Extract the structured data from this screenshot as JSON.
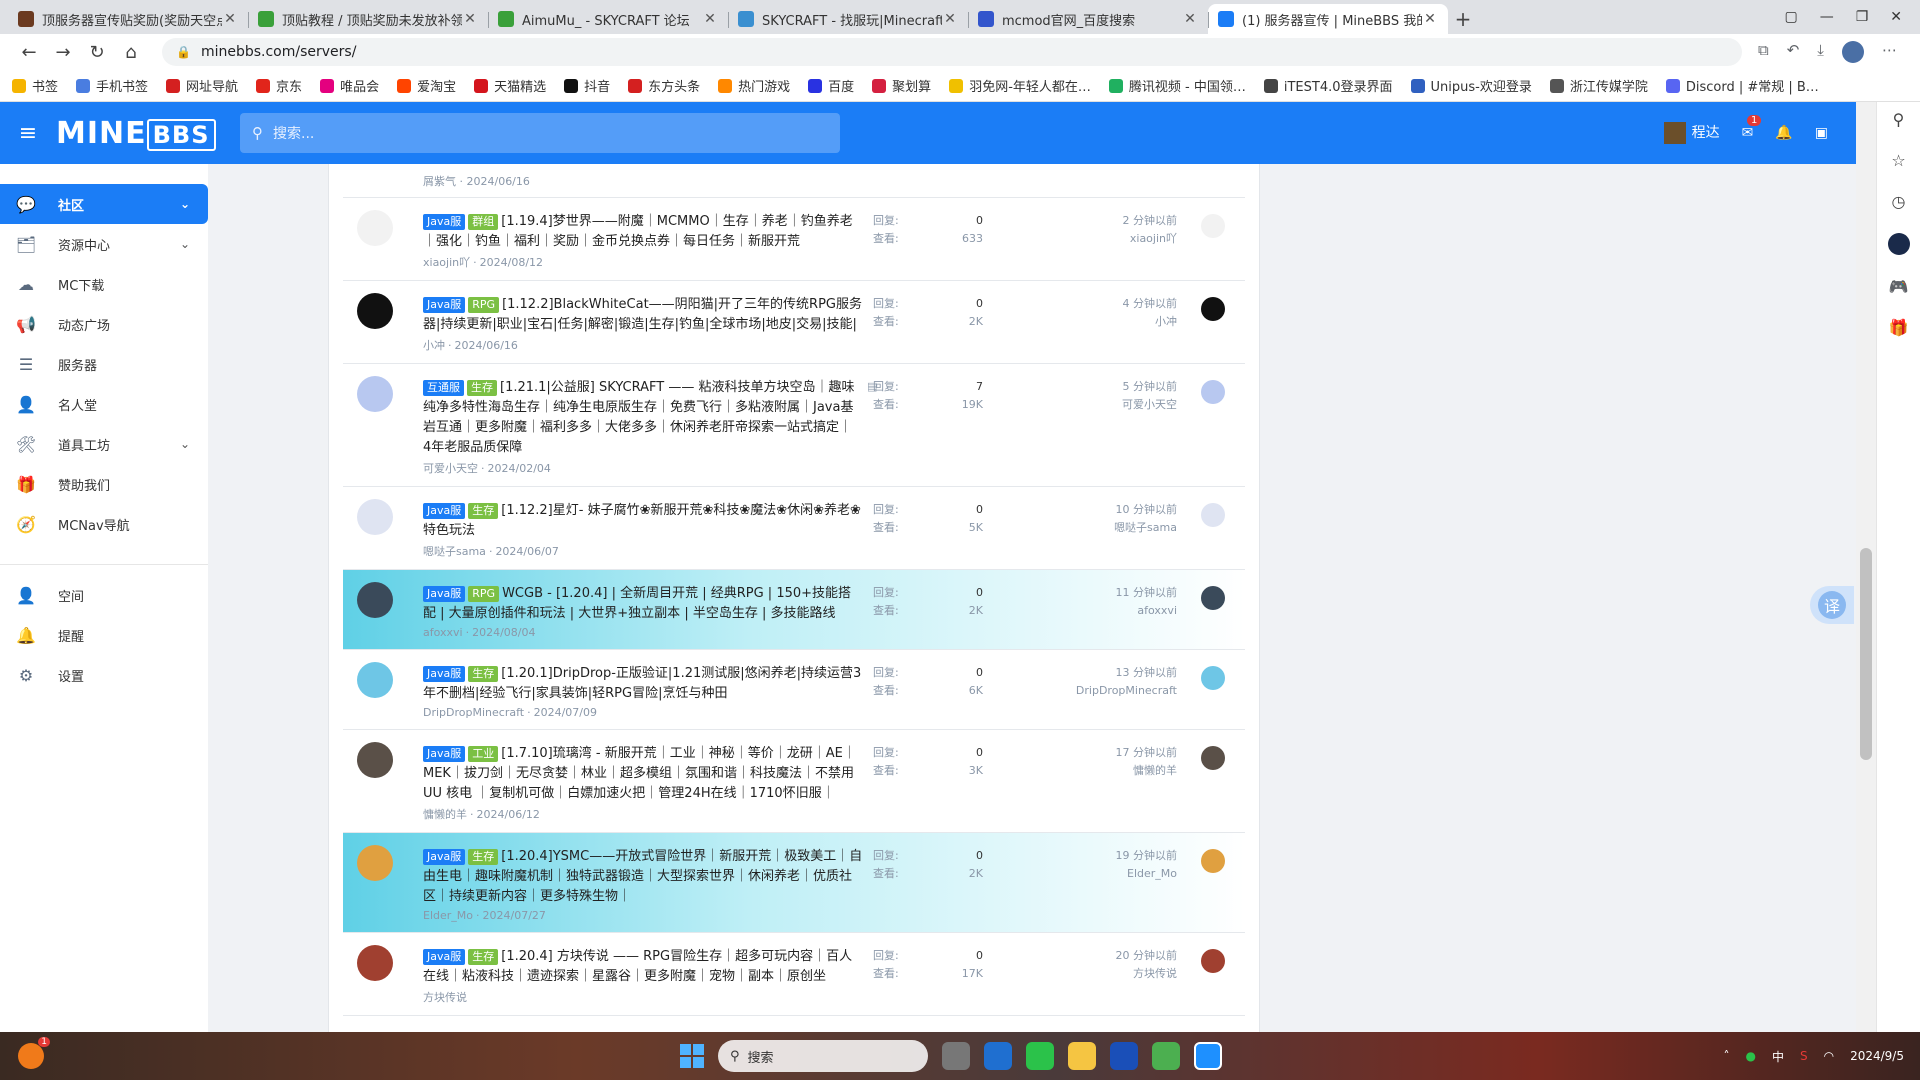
{
  "browser": {
    "tabs": [
      {
        "title": "顶服务器宣传贴奖励(奖励天空点卡…",
        "color": "#6b3a20",
        "active": false
      },
      {
        "title": "顶贴教程 / 顶贴奖励未发放补领…",
        "color": "#3aa03a",
        "active": false
      },
      {
        "title": "AimuMu_ - SKYCRAFT 论坛",
        "color": "#3aa03a",
        "active": false
      },
      {
        "title": "SKYCRAFT - 找服玩|Minecraft服…",
        "color": "#3a8fd0",
        "active": false
      },
      {
        "title": "mcmod官网_百度搜索",
        "color": "#3355cc",
        "active": false
      },
      {
        "title": "(1) 服务器宣传 | MineBBS 我的世…",
        "color": "#1b7df6",
        "active": true
      }
    ],
    "new_tab": "+",
    "url": "minebbs.com/servers/",
    "bookmarks": [
      {
        "label": "书签",
        "color": "#f5b400"
      },
      {
        "label": "手机书签",
        "color": "#4a7de0"
      },
      {
        "label": "网址导航",
        "color": "#d42020"
      },
      {
        "label": "京东",
        "color": "#e1251b"
      },
      {
        "label": "唯品会",
        "color": "#e4007f"
      },
      {
        "label": "爱淘宝",
        "color": "#ff4400"
      },
      {
        "label": "天猫精选",
        "color": "#d4151d"
      },
      {
        "label": "抖音",
        "color": "#111111"
      },
      {
        "label": "东方头条",
        "color": "#d42020"
      },
      {
        "label": "热门游戏",
        "color": "#ff8800"
      },
      {
        "label": "百度",
        "color": "#2932e1"
      },
      {
        "label": "聚划算",
        "color": "#d42040"
      },
      {
        "label": "羽免网-年轻人都在…",
        "color": "#f0c000"
      },
      {
        "label": "腾讯视频 - 中国领…",
        "color": "#20b060"
      },
      {
        "label": "iTEST4.0登录界面",
        "color": "#444444"
      },
      {
        "label": "Unipus-欢迎登录",
        "color": "#3060c0"
      },
      {
        "label": "浙江传媒学院",
        "color": "#555555"
      },
      {
        "label": "Discord | #常规 | B…",
        "color": "#5865f2"
      }
    ]
  },
  "site": {
    "logo_main": "MINE",
    "logo_box": "BBS",
    "search_placeholder": "搜索...",
    "username": "程达",
    "mail_badge": "1"
  },
  "nav": [
    {
      "label": "社区",
      "icon": "comments-icon",
      "active": true,
      "chevron": true
    },
    {
      "label": "资源中心",
      "icon": "resources-icon",
      "active": false,
      "chevron": true
    },
    {
      "label": "MC下载",
      "icon": "cloud-download-icon",
      "active": false,
      "chevron": false
    },
    {
      "label": "动态广场",
      "icon": "megaphone-icon",
      "active": false,
      "chevron": false
    },
    {
      "label": "服务器",
      "icon": "server-icon",
      "active": false,
      "chevron": false
    },
    {
      "label": "名人堂",
      "icon": "user-tie-icon",
      "active": false,
      "chevron": false
    },
    {
      "label": "道具工坊",
      "icon": "tools-icon",
      "active": false,
      "chevron": true
    },
    {
      "label": "赞助我们",
      "icon": "donate-icon",
      "active": false,
      "chevron": false
    },
    {
      "label": "MCNav导航",
      "icon": "compass-icon",
      "active": false,
      "chevron": false
    }
  ],
  "nav_bottom": [
    {
      "label": "空间",
      "icon": "user-icon"
    },
    {
      "label": "提醒",
      "icon": "bell-icon"
    },
    {
      "label": "设置",
      "icon": "gear-icon"
    }
  ],
  "prev_meta": "屑紫气 · 2024/06/16",
  "labels": {
    "replies": "回复:",
    "views": "查看:"
  },
  "threads": [
    {
      "tags": [
        {
          "text": "Java服",
          "color": "#1b7df6"
        },
        {
          "text": "群组",
          "color": "#7bc043"
        }
      ],
      "title": "[1.19.4]梦世界——附魔｜MCMMO｜生存｜养老｜钓鱼养老｜强化｜钓鱼｜福利｜奖励｜金币兑换点券｜每日任务｜新服开荒",
      "author": "xiaojin吖",
      "date": "2024/08/12",
      "replies": "0",
      "views": "633",
      "latest_time": "2 分钟以前",
      "latest_user": "xiaojin吖",
      "avatar_color": "#f2f2f2",
      "highlight": false,
      "file": false
    },
    {
      "tags": [
        {
          "text": "Java服",
          "color": "#1b7df6"
        },
        {
          "text": "RPG",
          "color": "#7bc043"
        }
      ],
      "title": "[1.12.2]BlackWhiteCat——阴阳猫|开了三年的传统RPG服务器|持续更新|职业|宝石|任务|解密|锻造|生存|钓鱼|全球市场|地皮|交易|技能|",
      "author": "小冲",
      "date": "2024/06/16",
      "replies": "0",
      "views": "2K",
      "latest_time": "4 分钟以前",
      "latest_user": "小冲",
      "avatar_color": "#111111",
      "highlight": false,
      "file": false
    },
    {
      "tags": [
        {
          "text": "互通服",
          "color": "#1b7df6"
        },
        {
          "text": "生存",
          "color": "#7bc043"
        }
      ],
      "title": "[1.21.1|公益服] SKYCRAFT —— 粘液科技单方块空岛｜趣味纯净多特性海岛生存｜纯净生电原版生存｜免费飞行｜多粘液附属｜Java基岩互通｜更多附魔｜福利多多｜大佬多多｜休闲养老肝帝探索一站式搞定｜ 4年老服品质保障",
      "author": "可爱小天空",
      "date": "2024/02/04",
      "replies": "7",
      "views": "19K",
      "latest_time": "5 分钟以前",
      "latest_user": "可爱小天空",
      "avatar_color": "#b8c8f0",
      "highlight": false,
      "file": true
    },
    {
      "tags": [
        {
          "text": "Java服",
          "color": "#1b7df6"
        },
        {
          "text": "生存",
          "color": "#7bc043"
        }
      ],
      "title": "[1.12.2]星灯- 妹子腐竹❀新服开荒❀科技❀魔法❀休闲❀养老❀特色玩法",
      "author": "嗯哒子sama",
      "date": "2024/06/07",
      "replies": "0",
      "views": "5K",
      "latest_time": "10 分钟以前",
      "latest_user": "嗯哒子sama",
      "avatar_color": "#dfe4f2",
      "highlight": false,
      "file": false
    },
    {
      "tags": [
        {
          "text": "Java服",
          "color": "#1b7df6"
        },
        {
          "text": "RPG",
          "color": "#7bc043"
        }
      ],
      "title": "WCGB - [1.20.4] | 全新周目开荒 | 经典RPG | 150+技能搭配 | 大量原创插件和玩法 | 大世界+独立副本 | 半空岛生存 | 多技能路线",
      "author": "afoxxvi",
      "date": "2024/08/04",
      "replies": "0",
      "views": "2K",
      "latest_time": "11 分钟以前",
      "latest_user": "afoxxvi",
      "avatar_color": "#3a4a5a",
      "highlight": true,
      "file": false
    },
    {
      "tags": [
        {
          "text": "Java服",
          "color": "#1b7df6"
        },
        {
          "text": "生存",
          "color": "#7bc043"
        }
      ],
      "title": "[1.20.1]DripDrop-正版验证|1.21测试服|悠闲养老|持续运营3年不删档|经验飞行|家具装饰|轻RPG冒险|烹饪与种田",
      "author": "DripDropMinecraft",
      "date": "2024/07/09",
      "replies": "0",
      "views": "6K",
      "latest_time": "13 分钟以前",
      "latest_user": "DripDropMinecraft",
      "avatar_color": "#6ec6e6",
      "highlight": false,
      "file": false
    },
    {
      "tags": [
        {
          "text": "Java服",
          "color": "#1b7df6"
        },
        {
          "text": "工业",
          "color": "#7bc043"
        }
      ],
      "title": "[1.7.10]琉璃湾 - 新服开荒｜工业｜神秘｜等价｜龙研｜AE｜MEK｜拔刀剑｜无尽贪婪｜林业｜超多模组｜氛围和谐｜科技魔法｜不禁用 UU 核电 ｜复制机可做｜白嫖加速火把｜管理24H在线｜1710怀旧服｜",
      "author": "慵懒的羊",
      "date": "2024/06/12",
      "replies": "0",
      "views": "3K",
      "latest_time": "17 分钟以前",
      "latest_user": "慵懒的羊",
      "avatar_color": "#5a5048",
      "highlight": false,
      "file": false
    },
    {
      "tags": [
        {
          "text": "Java服",
          "color": "#1b7df6"
        },
        {
          "text": "生存",
          "color": "#7bc043"
        }
      ],
      "title": "[1.20.4]YSMC——开放式冒险世界｜新服开荒｜极致美工｜自由生电｜趣味附魔机制｜独特武器锻造｜大型探索世界｜休闲养老｜优质社区｜持续更新内容｜更多特殊生物｜",
      "author": "Elder_Mo",
      "date": "2024/07/27",
      "replies": "0",
      "views": "2K",
      "latest_time": "19 分钟以前",
      "latest_user": "Elder_Mo",
      "avatar_color": "#e0a040",
      "highlight": true,
      "file": false
    },
    {
      "tags": [
        {
          "text": "Java服",
          "color": "#1b7df6"
        },
        {
          "text": "生存",
          "color": "#7bc043"
        }
      ],
      "title": "[1.20.4] 方块传说 —— RPG冒险生存｜超多可玩内容｜百人在线｜粘液科技｜遗迹探索｜星露谷｜更多附魔｜宠物｜副本｜原创坐",
      "author": "方块传说",
      "date": "",
      "replies": "0",
      "views": "17K",
      "latest_time": "20 分钟以前",
      "latest_user": "方块传说",
      "avatar_color": "#a04030",
      "highlight": false,
      "file": false
    }
  ],
  "translate_label": "译",
  "taskbar": {
    "search_placeholder": "搜索",
    "notify_badge": "1",
    "ime": "中",
    "clock": "2024/9/5"
  }
}
